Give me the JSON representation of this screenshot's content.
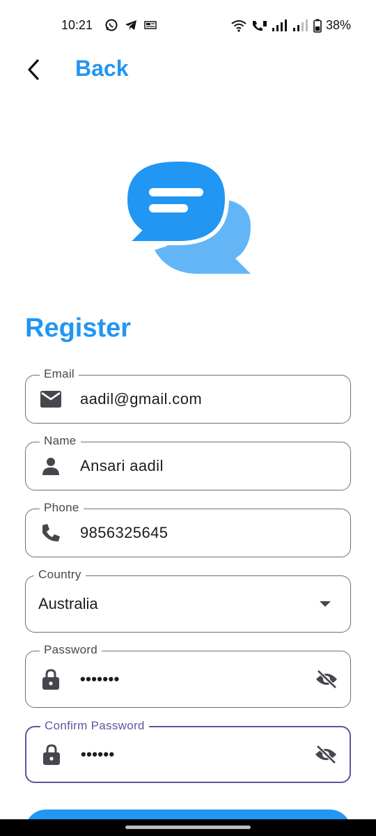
{
  "status_bar": {
    "time": "10:21",
    "battery": "38%",
    "left_icons": [
      "whatsapp-icon",
      "telegram-icon",
      "news-icon"
    ],
    "right_icons": [
      "wifi-icon",
      "volte-call-icon",
      "signal-icon",
      "signal-weak-icon",
      "battery-icon"
    ]
  },
  "header": {
    "back_label": "Back",
    "back_icon": "chevron-left-icon"
  },
  "logo": {
    "icon": "chat-bubbles-icon",
    "front_color": "#2196f3",
    "back_color": "#64b5f6"
  },
  "page": {
    "title": "Register"
  },
  "form": {
    "email": {
      "label": "Email",
      "value": "aadil@gmail.com",
      "icon": "mail-icon"
    },
    "name": {
      "label": "Name",
      "value": "Ansari aadil",
      "icon": "person-icon"
    },
    "phone": {
      "label": "Phone",
      "value": "9856325645",
      "icon": "phone-icon"
    },
    "country": {
      "label": "Country",
      "value": "Australia"
    },
    "password": {
      "label": "Password",
      "value": "•••••••",
      "icon": "lock-icon",
      "toggle_icon": "eye-off-icon"
    },
    "confirm_password": {
      "label": "Confirm Password",
      "value": "••••••",
      "icon": "lock-icon",
      "toggle_icon": "eye-off-icon"
    }
  },
  "colors": {
    "primary": "#2196f3",
    "focus": "#6750a4",
    "outline": "#6f6f73"
  }
}
